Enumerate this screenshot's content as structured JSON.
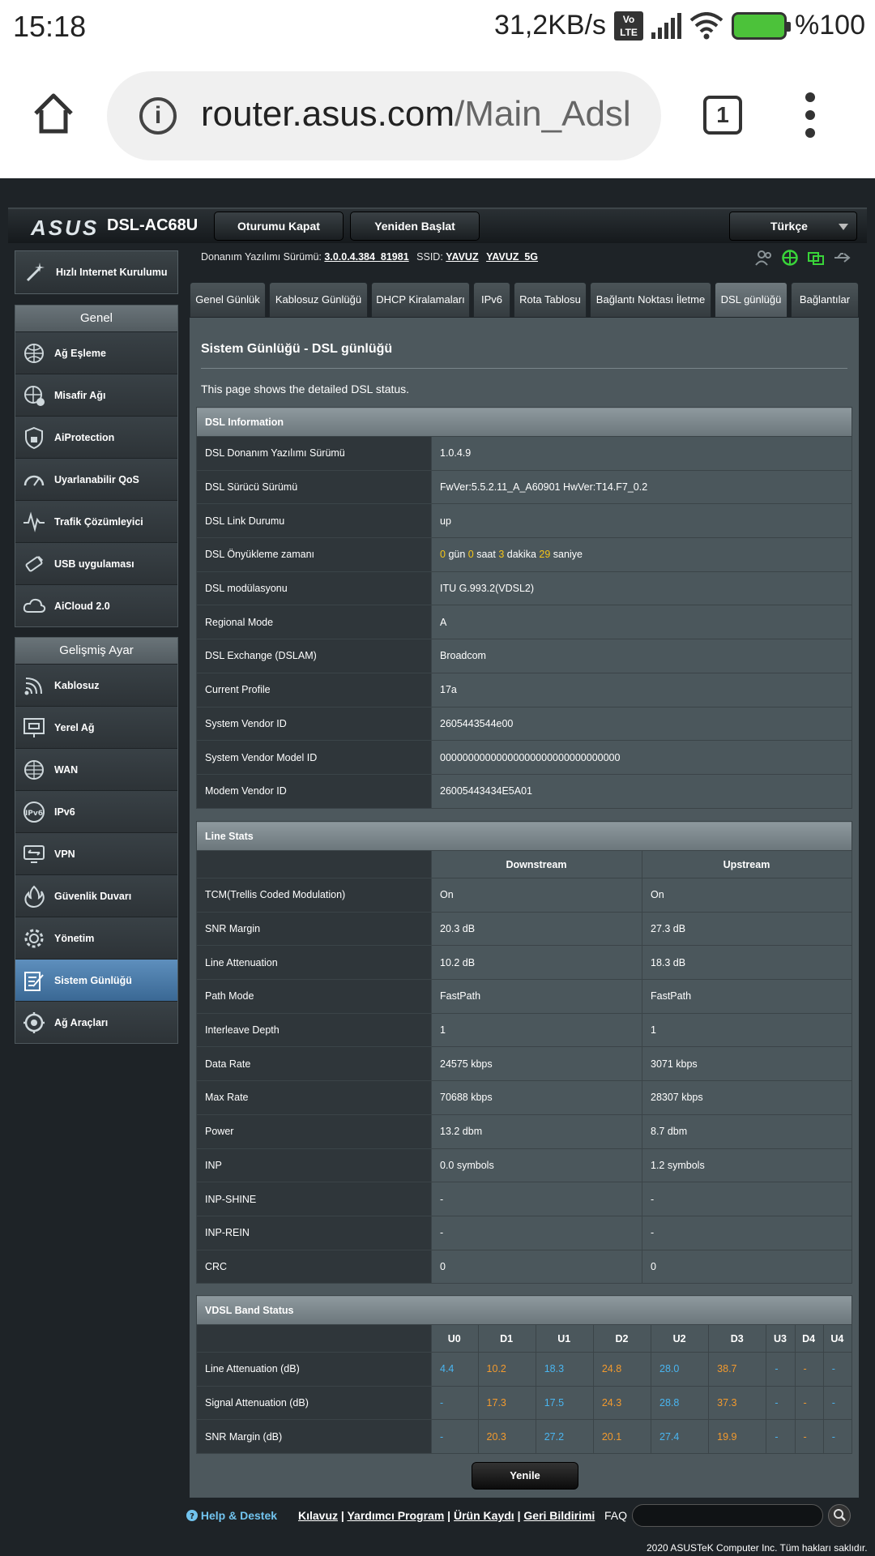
{
  "status": {
    "time": "15:18",
    "speed": "31,2KB/s",
    "volte": "Vo LTE",
    "battery": "%100"
  },
  "browser": {
    "url_host": "router.asus.com",
    "url_path": "/Main_Adsl",
    "tab_count": "1"
  },
  "header": {
    "logo": "ASUS",
    "model": "DSL-AC68U",
    "logout_label": "Oturumu Kapat",
    "reboot_label": "Yeniden Başlat",
    "language": "Türkçe"
  },
  "firmware": {
    "fw_label": "Donanım Yazılımı Sürümü:",
    "fw_version": "3.0.0.4.384_81981",
    "ssid_label": "SSID:",
    "ssid_1": "YAVUZ",
    "ssid_2": "YAVUZ_5G"
  },
  "sidebar": {
    "quick_setup": "Hızlı Internet Kurulumu",
    "general_title": "Genel",
    "general_items": [
      {
        "label": "Ağ Eşleme"
      },
      {
        "label": "Misafir Ağı"
      },
      {
        "label": "AiProtection"
      },
      {
        "label": "Uyarlanabilir QoS"
      },
      {
        "label": "Trafik Çözümleyici"
      },
      {
        "label": "USB uygulaması"
      },
      {
        "label": "AiCloud 2.0"
      }
    ],
    "advanced_title": "Gelişmiş Ayar",
    "advanced_items": [
      {
        "label": "Kablosuz"
      },
      {
        "label": "Yerel Ağ"
      },
      {
        "label": "WAN"
      },
      {
        "label": "IPv6"
      },
      {
        "label": "VPN"
      },
      {
        "label": "Güvenlik Duvarı"
      },
      {
        "label": "Yönetim"
      },
      {
        "label": "Sistem Günlüğü"
      },
      {
        "label": "Ağ Araçları"
      }
    ]
  },
  "tabs": [
    {
      "label": "Genel Günlük"
    },
    {
      "label": "Kablosuz Günlüğü"
    },
    {
      "label": "DHCP Kiralamaları"
    },
    {
      "label": "IPv6"
    },
    {
      "label": "Rota Tablosu"
    },
    {
      "label": "Bağlantı Noktası İletme"
    },
    {
      "label": "DSL günlüğü"
    },
    {
      "label": "Bağlantılar"
    }
  ],
  "content": {
    "title": "Sistem Günlüğü - DSL günlüğü",
    "description": "This page shows the detailed DSL status."
  },
  "dsl_info": {
    "title": "DSL Information",
    "rows": [
      {
        "k": "DSL Donanım Yazılımı Sürümü",
        "v": "1.0.4.9"
      },
      {
        "k": "DSL Sürücü Sürümü",
        "v": "FwVer:5.5.2.11_A_A60901 HwVer:T14.F7_0.2"
      },
      {
        "k": "DSL Link Durumu",
        "v": "up"
      },
      {
        "k": "DSL Önyükleme zamanı",
        "v": ""
      },
      {
        "k": "DSL modülasyonu",
        "v": "ITU G.993.2(VDSL2)"
      },
      {
        "k": "Regional Mode",
        "v": "A"
      },
      {
        "k": "DSL Exchange (DSLAM)",
        "v": "Broadcom"
      },
      {
        "k": "Current Profile",
        "v": "17a"
      },
      {
        "k": "System Vendor ID",
        "v": "2605443544e00"
      },
      {
        "k": "System Vendor Model ID",
        "v": "00000000000000000000000000000000"
      },
      {
        "k": "Modem Vendor ID",
        "v": "26005443434E5A01"
      }
    ],
    "uptime": {
      "days": "0",
      "days_unit": "gün",
      "hours": "0",
      "hours_unit": "saat",
      "minutes": "3",
      "minutes_unit": "dakika",
      "seconds": "29",
      "seconds_unit": "saniye"
    }
  },
  "line_stats": {
    "title": "Line Stats",
    "col_down": "Downstream",
    "col_up": "Upstream",
    "rows": [
      {
        "k": "TCM(Trellis Coded Modulation)",
        "d": "On",
        "u": "On"
      },
      {
        "k": "SNR Margin",
        "d": "20.3 dB",
        "u": "27.3 dB"
      },
      {
        "k": "Line Attenuation",
        "d": "10.2 dB",
        "u": "18.3 dB"
      },
      {
        "k": "Path Mode",
        "d": "FastPath",
        "u": "FastPath"
      },
      {
        "k": "Interleave Depth",
        "d": "1",
        "u": "1"
      },
      {
        "k": "Data Rate",
        "d": "24575 kbps",
        "u": "3071 kbps"
      },
      {
        "k": "Max Rate",
        "d": "70688 kbps",
        "u": "28307 kbps"
      },
      {
        "k": "Power",
        "d": "13.2 dbm",
        "u": "8.7 dbm"
      },
      {
        "k": "INP",
        "d": "0.0 symbols",
        "u": "1.2 symbols"
      },
      {
        "k": "INP-SHINE",
        "d": "-",
        "u": "-"
      },
      {
        "k": "INP-REIN",
        "d": "-",
        "u": "-"
      },
      {
        "k": "CRC",
        "d": "0",
        "u": "0"
      }
    ]
  },
  "vdsl": {
    "title": "VDSL Band Status",
    "bands": [
      "U0",
      "D1",
      "U1",
      "D2",
      "U2",
      "D3",
      "U3",
      "D4",
      "U4"
    ],
    "rows": [
      {
        "k": "Line Attenuation (dB)",
        "vals": [
          "4.4",
          "10.2",
          "18.3",
          "24.8",
          "28.0",
          "38.7",
          "-",
          "-",
          "-"
        ]
      },
      {
        "k": "Signal Attenuation (dB)",
        "vals": [
          "-",
          "17.3",
          "17.5",
          "24.3",
          "28.8",
          "37.3",
          "-",
          "-",
          "-"
        ]
      },
      {
        "k": "SNR Margin (dB)",
        "vals": [
          "-",
          "20.3",
          "27.2",
          "20.1",
          "27.4",
          "19.9",
          "-",
          "-",
          "-"
        ]
      }
    ],
    "colors": {
      "upstream": "#49b5f0",
      "downstream": "#f29a2e"
    }
  },
  "refresh_label": "Yenile",
  "footer": {
    "help": "Help & Destek",
    "links": [
      "Kılavuz",
      "Yardımcı Program",
      "Ürün Kaydı",
      "Geri Bildirimi"
    ],
    "faq": "FAQ",
    "copyright": "2020 ASUSTeK Computer Inc. Tüm hakları saklıdır."
  }
}
